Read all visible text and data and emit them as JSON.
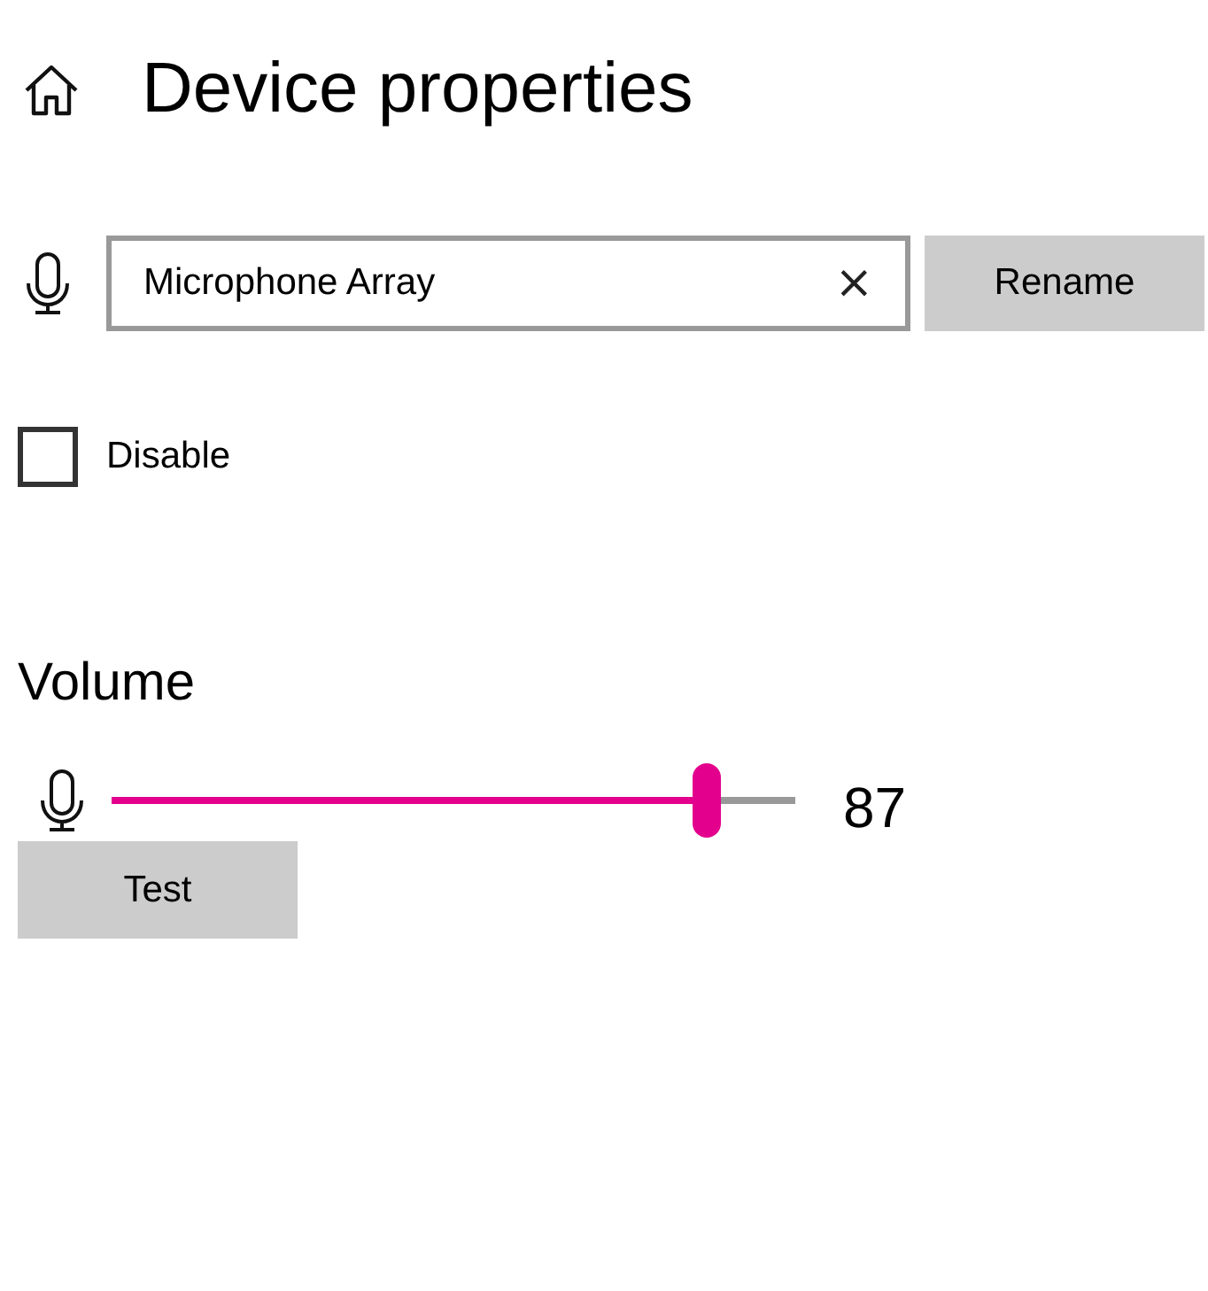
{
  "page": {
    "title": "Device properties"
  },
  "name_field": {
    "value": "Microphone Array",
    "clear": "×"
  },
  "rename_button": {
    "label": "Rename"
  },
  "disable": {
    "label": "Disable",
    "checked": false
  },
  "volume": {
    "heading": "Volume",
    "level": 0.87,
    "reading": "87"
  },
  "test_button": {
    "label": "Test"
  }
}
